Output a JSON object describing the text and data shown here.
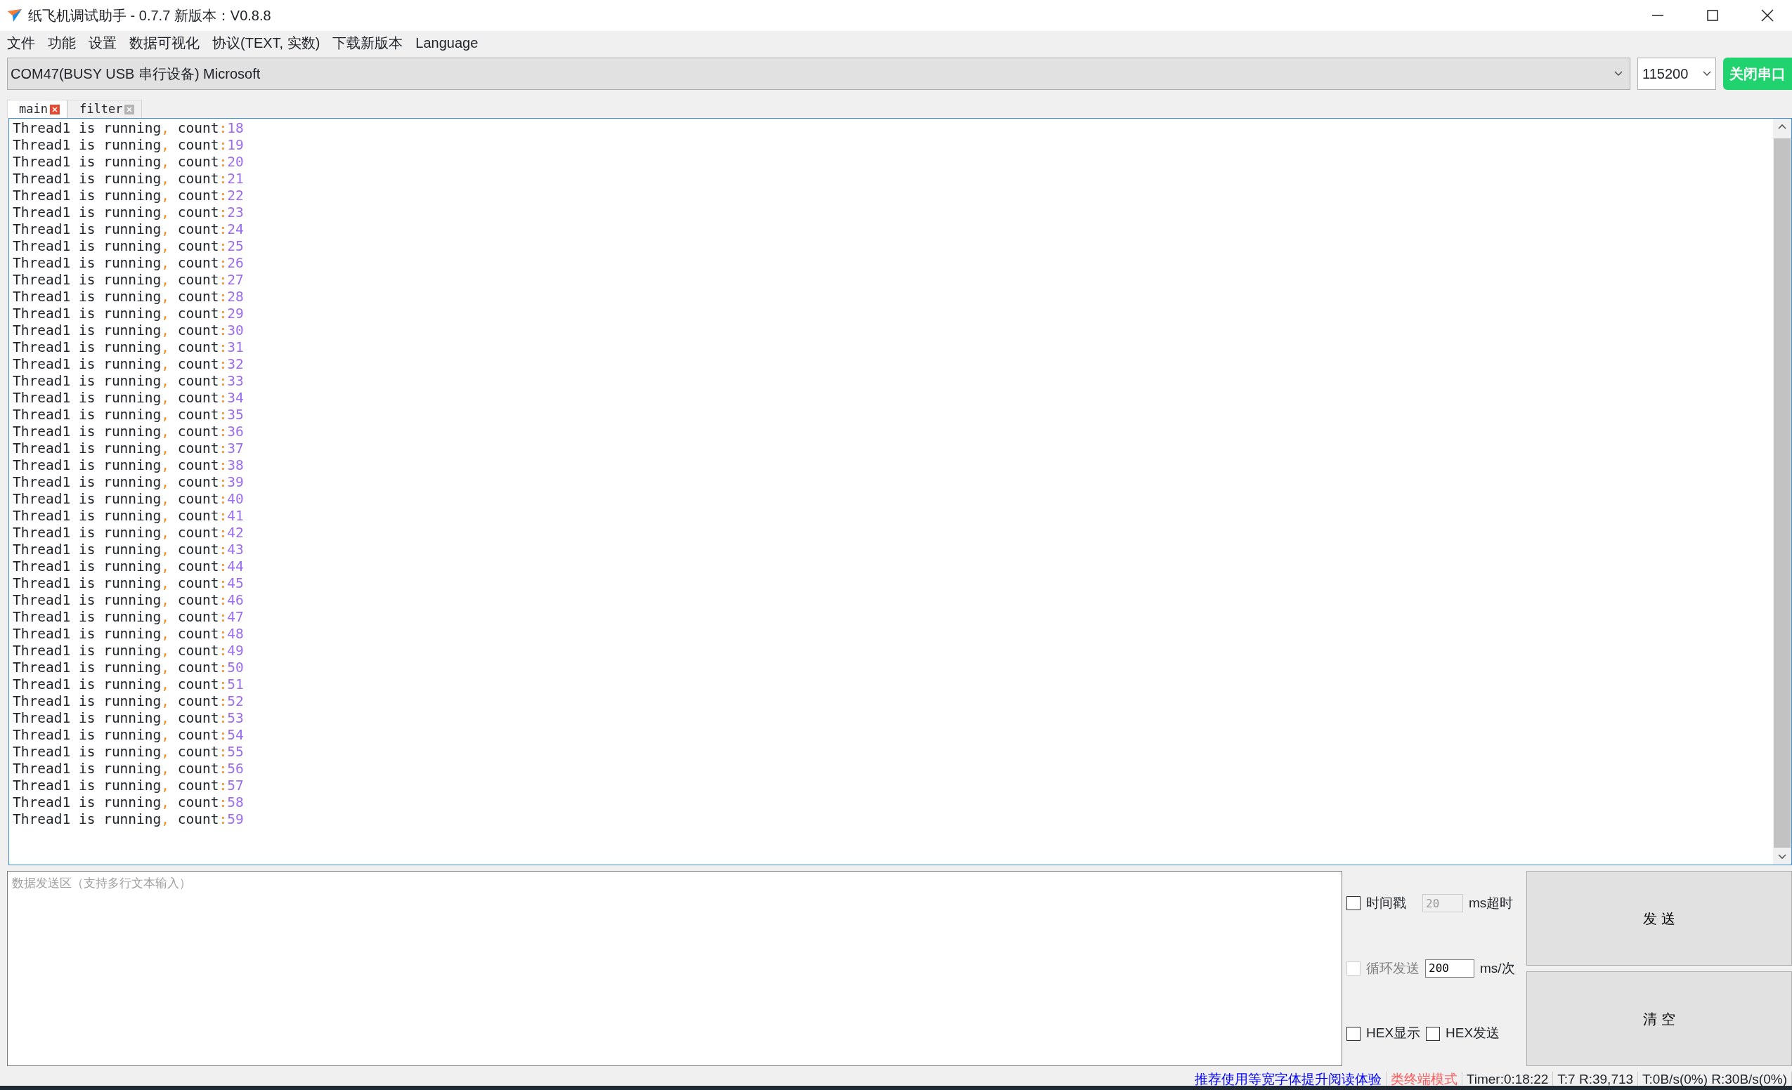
{
  "window": {
    "title": "纸飞机调试助手 - 0.7.7 新版本：V0.8.8"
  },
  "menu": [
    "文件",
    "功能",
    "设置",
    "数据可视化",
    "协议(TEXT, 实数)",
    "下载新版本",
    "Language"
  ],
  "port": {
    "value": "COM47(BUSY  USB 串行设备) Microsoft",
    "baud": "115200",
    "button": "关闭串口"
  },
  "tabs": [
    {
      "label": "main",
      "selected": true
    },
    {
      "label": "filter",
      "selected": false
    }
  ],
  "log": [
    "Thread1 is running, count:18",
    "Thread1 is running, count:19",
    "Thread1 is running, count:20",
    "Thread1 is running, count:21",
    "Thread1 is running, count:22",
    "Thread1 is running, count:23",
    "Thread1 is running, count:24",
    "Thread1 is running, count:25",
    "Thread1 is running, count:26",
    "Thread1 is running, count:27",
    "Thread1 is running, count:28",
    "Thread1 is running, count:29",
    "Thread1 is running, count:30",
    "Thread1 is running, count:31",
    "Thread1 is running, count:32",
    "Thread1 is running, count:33",
    "Thread1 is running, count:34",
    "Thread1 is running, count:35",
    "Thread1 is running, count:36",
    "Thread1 is running, count:37",
    "Thread1 is running, count:38",
    "Thread1 is running, count:39",
    "Thread1 is running, count:40",
    "Thread1 is running, count:41",
    "Thread1 is running, count:42",
    "Thread1 is running, count:43",
    "Thread1 is running, count:44",
    "Thread1 is running, count:45",
    "Thread1 is running, count:46",
    "Thread1 is running, count:47",
    "Thread1 is running, count:48",
    "Thread1 is running, count:49",
    "Thread1 is running, count:50",
    "Thread1 is running, count:51",
    "Thread1 is running, count:52",
    "Thread1 is running, count:53",
    "Thread1 is running, count:54",
    "Thread1 is running, count:55",
    "Thread1 is running, count:56",
    "Thread1 is running, count:57",
    "Thread1 is running, count:58",
    "Thread1 is running, count:59"
  ],
  "send_area": {
    "placeholder": "数据发送区（支持多行文本输入）"
  },
  "options": {
    "timestamp": {
      "label": "时间戳",
      "checked": false,
      "timeout": "20",
      "unit": "ms超时"
    },
    "loop": {
      "label": "循环发送",
      "checked": false,
      "disabled": true,
      "interval": "200",
      "unit": "ms/次"
    },
    "hex_display": {
      "label": "HEX显示",
      "checked": false
    },
    "hex_send": {
      "label": "HEX发送",
      "checked": false
    }
  },
  "buttons": {
    "send": "发 送",
    "clear": "清 空"
  },
  "status_bar": [
    {
      "kind": "link",
      "text": "推荐使用等宽字体提升阅读体验"
    },
    {
      "kind": "warning",
      "text": "类终端模式"
    },
    {
      "kind": "text",
      "text": "Timer:0:18:22"
    },
    {
      "kind": "text",
      "text": "T:7 R:39,713"
    },
    {
      "kind": "text",
      "text": "T:0B/s(0%) R:30B/s(0%)"
    }
  ]
}
